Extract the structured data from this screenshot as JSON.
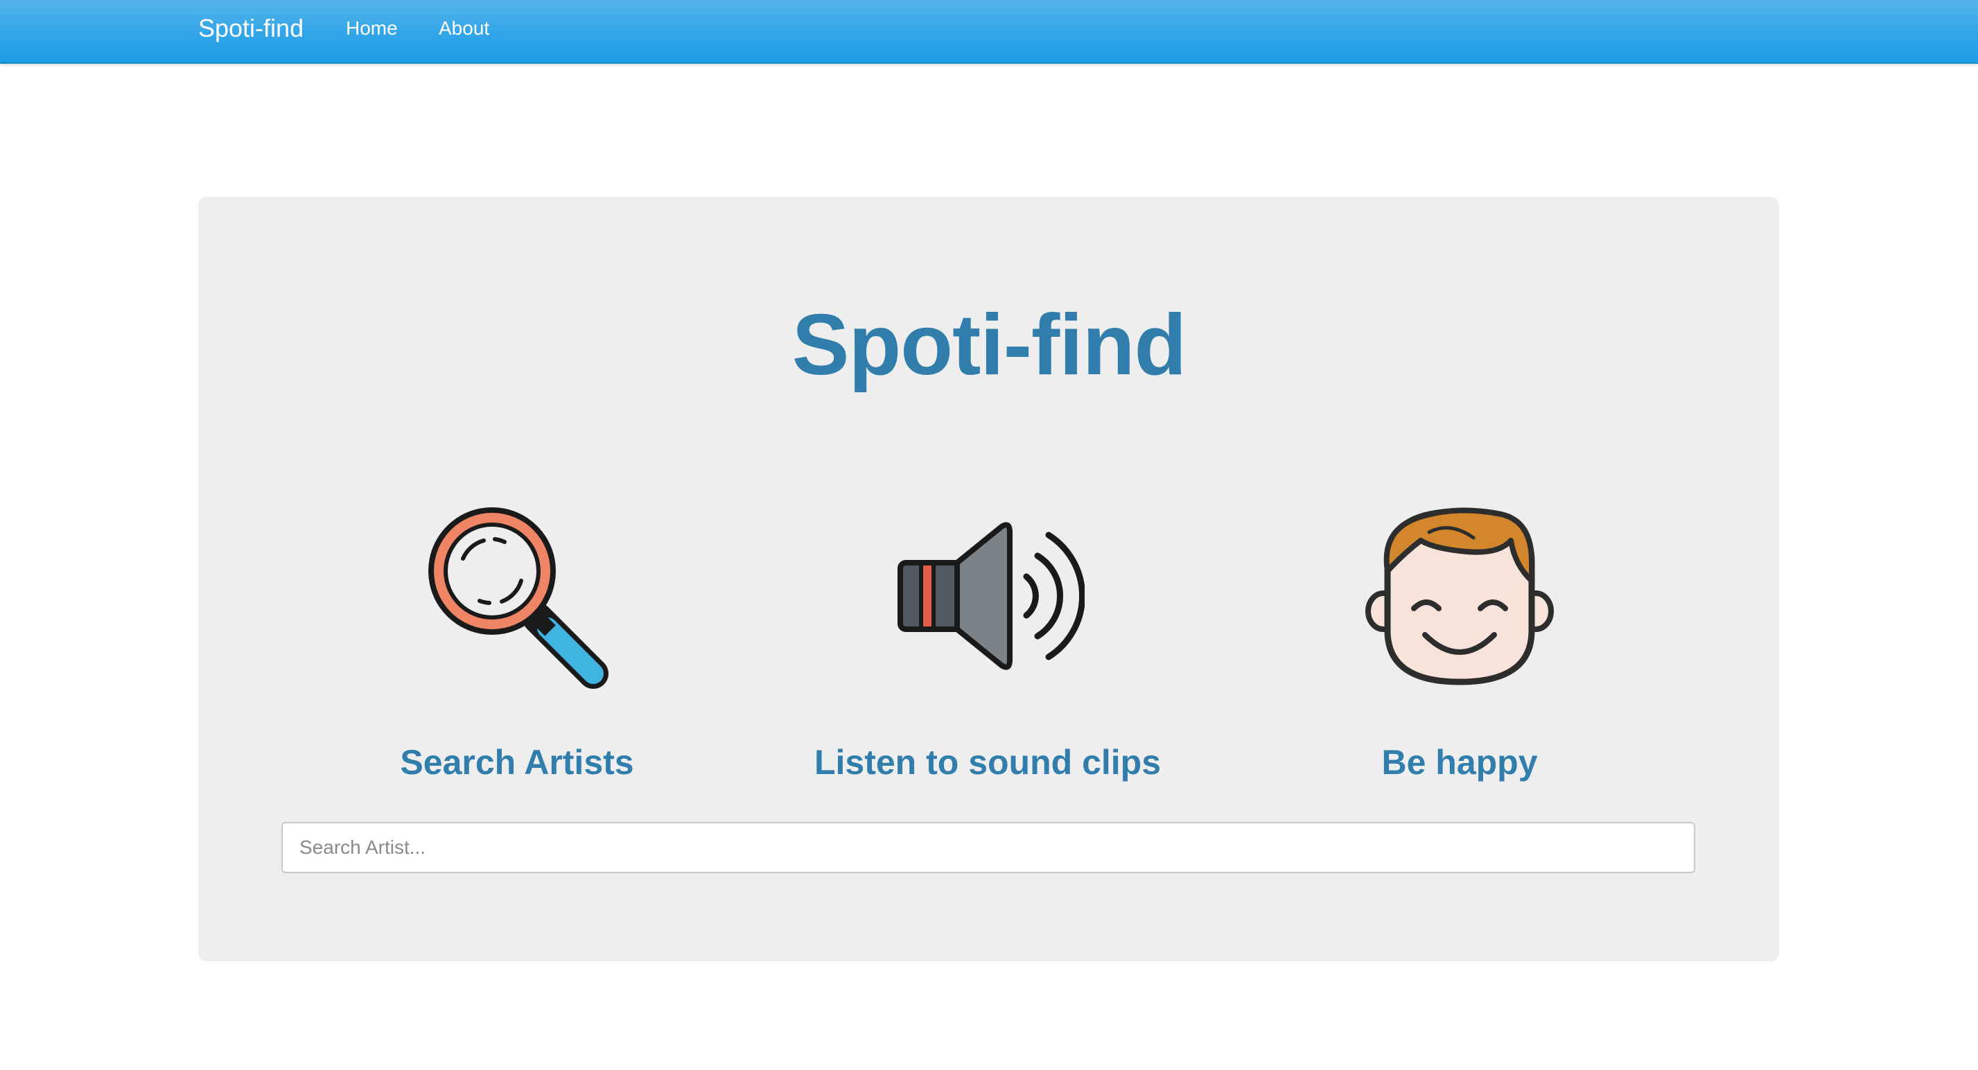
{
  "navbar": {
    "brand": "Spoti-find",
    "links": [
      {
        "label": "Home"
      },
      {
        "label": "About"
      }
    ],
    "background_color": "#2fa4e7"
  },
  "hero": {
    "title": "Spoti-find",
    "title_color": "#317eac"
  },
  "features": [
    {
      "icon": "magnifying-glass-icon",
      "label": "Search Artists"
    },
    {
      "icon": "speaker-icon",
      "label": "Listen to sound clips"
    },
    {
      "icon": "happy-face-icon",
      "label": "Be happy"
    }
  ],
  "search": {
    "placeholder": "Search Artist...",
    "value": ""
  }
}
